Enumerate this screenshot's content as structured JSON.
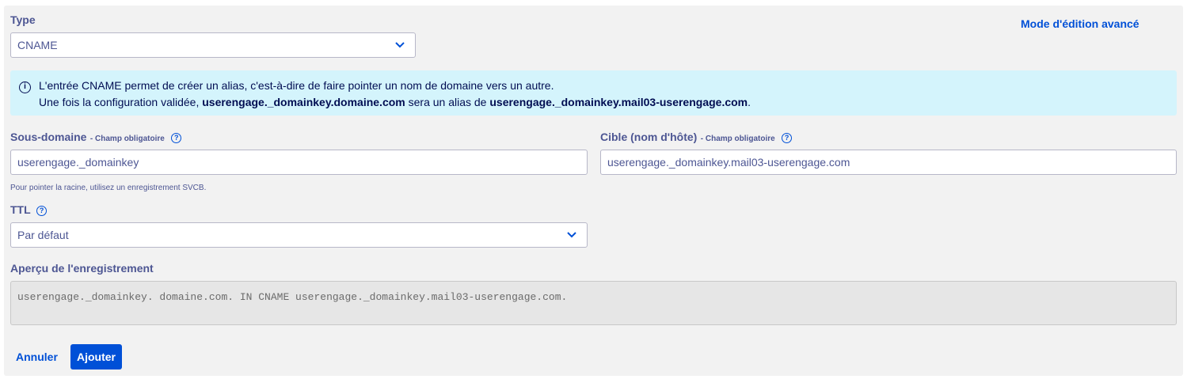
{
  "type_label": "Type",
  "type_value": "CNAME",
  "advanced_mode_link": "Mode d'édition avancé",
  "info": {
    "line1": "L'entrée CNAME permet de créer un alias, c'est-à-dire de faire pointer un nom de domaine vers un autre.",
    "line2_prefix": "Une fois la configuration validée, ",
    "line2_source": "userengage._domainkey.domaine.com",
    "line2_middle": " sera un alias de ",
    "line2_target": "userengage._domainkey.mail03-userengage.com",
    "line2_suffix": "."
  },
  "subdomain": {
    "label": "Sous-domaine",
    "required": "- Champ obligatoire",
    "value": "userengage._domainkey",
    "hint": "Pour pointer la racine, utilisez un enregistrement SVCB."
  },
  "target": {
    "label": "Cible (nom d'hôte)",
    "required": "- Champ obligatoire",
    "value": "userengage._domainkey.mail03-userengage.com"
  },
  "ttl": {
    "label": "TTL",
    "value": "Par défaut"
  },
  "preview": {
    "label": "Aperçu de l'enregistrement",
    "value": "userengage._domainkey. domaine.com. IN CNAME userengage._domainkey.mail03-userengage.com."
  },
  "buttons": {
    "cancel": "Annuler",
    "submit": "Ajouter"
  },
  "icons": {
    "help": "?",
    "info": "i"
  }
}
